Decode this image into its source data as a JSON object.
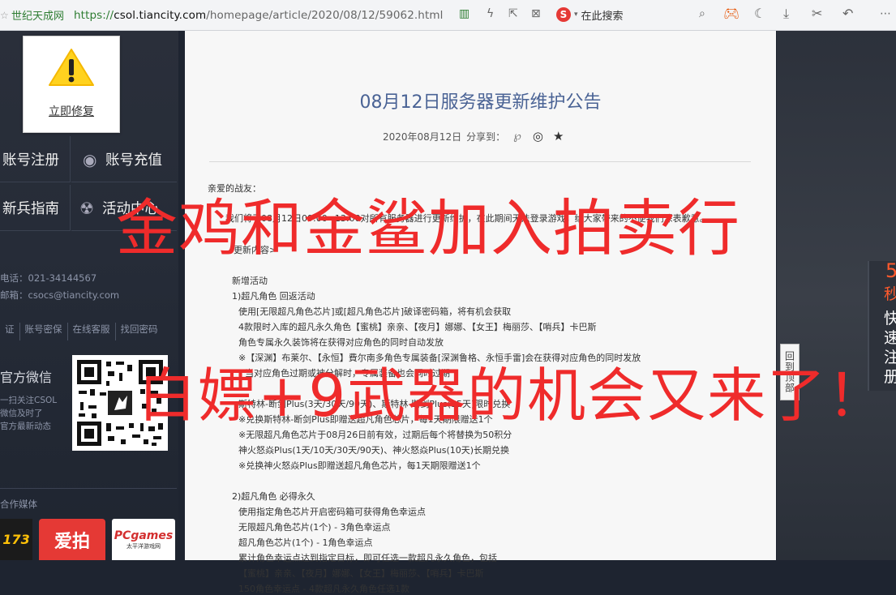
{
  "browser": {
    "site_name": "世纪天成网",
    "url_protocol": "https://",
    "url_host": "csol.tiancity.com",
    "url_path": "/homepage/article/2020/08/12/59062.html",
    "search_placeholder": "在此搜索"
  },
  "sidebar": {
    "fix_label": "立即修复",
    "nav": [
      "账号注册",
      "账号充值",
      "新兵指南",
      "活动中心"
    ],
    "contact_phone": "电话：021-34144567",
    "contact_email": "邮箱：csocs@tiancity.com",
    "links": [
      "证",
      "账号密保",
      "在线客服",
      "找回密码"
    ],
    "wechat_title": "官方微信",
    "wechat_desc": [
      "一扫关注CSOL",
      "微信及时了",
      "官方最新动态"
    ],
    "partner_title": "合作媒体",
    "partner_logos": [
      "173",
      "爱拍",
      "PCgames"
    ],
    "partner_sub": "太平洋游戏网"
  },
  "article": {
    "title": "08月12日服务器更新维护公告",
    "date": "2020年08月12日",
    "share_label": "分享到：",
    "lines": [
      "亲爱的战友：",
      "我们将于08月12日09:00~13:00对所有服务器进行更新维护，在此期间无法登录游戏，给大家带来的不便我们深表歉意。",
      "更新内容>",
      "新增活动",
      "1)超凡角色 回返活动",
      "使用[无限超凡角色芯片]或[超凡角色芯片]破译密码箱，将有机会获取",
      "4款限时入库的超凡永久角色【蜜桃】亲亲、【夜月】娜娜、【女王】梅丽莎、【哨兵】卡巴斯",
      "角色专属永久装饰将在获得对应角色的同时自动发放",
      "※【深渊】布莱尔、【永恒】費尔南多角色专属装备[深渊鲁格、永恒手雷]会在获得对应角色的同时发放",
      "当对应角色过期或被分解时，专属装备也会同时过期",
      "斯特林-断剑Plus(3天/30天/90天)、斯特林-断剑Plus(15天)限时兑换",
      "※兑换斯特林-断剑Plus即赠送超凡角色芯片，每1天期限赠送1个",
      "※无限超凡角色芯片于08月26日前有效，过期后每个将替换为50积分",
      "神火怒焱Plus(1天/10天/30天/90天)、神火怒焱Plus(10天)长期兑换",
      "※兑换神火怒焱Plus即赠送超凡角色芯片，每1天期限赠送1个",
      "2)超凡角色 必得永久",
      "使用指定角色芯片开启密码箱可获得角色幸运点",
      "无限超凡角色芯片(1个) - 3角色幸运点",
      "超凡角色芯片(1个) - 1角色幸运点",
      "累计角色幸运点达到指定目标，即可任选一款超凡永久角色，包括",
      "【蜜桃】亲亲、【夜月】娜娜、【女王】梅丽莎、【哨兵】卡巴斯",
      "150角色幸运点 - 4款超凡永久角色任选1款"
    ]
  },
  "overlay": {
    "line1": "金鸡和金鲨加入拍卖行",
    "line2": "白嫖+9武器的机会又来了！"
  },
  "widgets": {
    "back_to_top": "回到顶部",
    "right_panel": [
      "5",
      "秒",
      "快",
      "速",
      "注",
      "册"
    ]
  }
}
